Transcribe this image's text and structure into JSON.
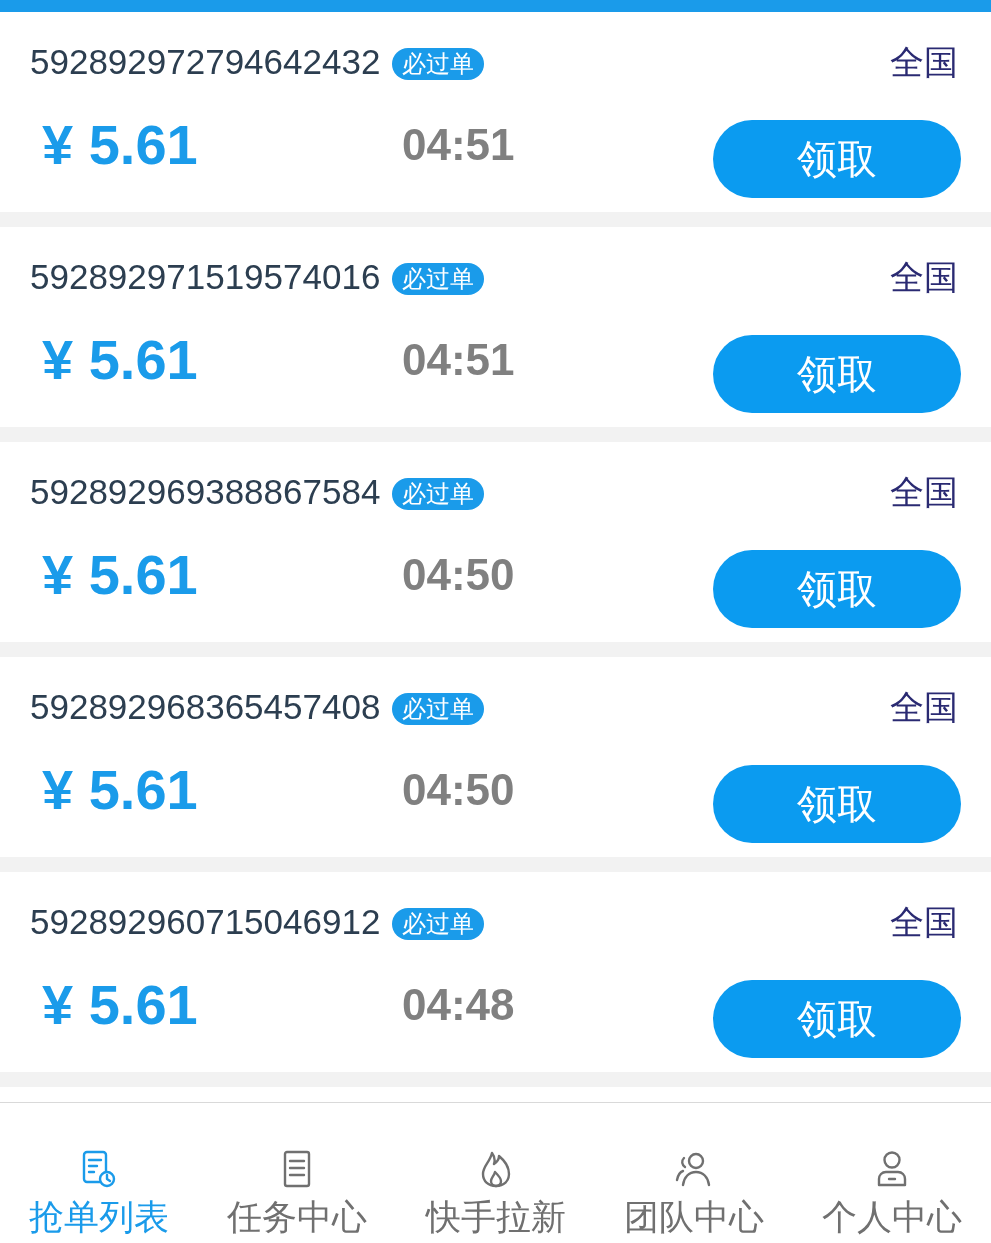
{
  "orders": [
    {
      "order_id": "592892972794642432",
      "badge": "必过单",
      "region": "全国",
      "price": "¥ 5.61",
      "countdown": "04:51",
      "button": "领取"
    },
    {
      "order_id": "592892971519574016",
      "badge": "必过单",
      "region": "全国",
      "price": "¥ 5.61",
      "countdown": "04:51",
      "button": "领取"
    },
    {
      "order_id": "592892969388867584",
      "badge": "必过单",
      "region": "全国",
      "price": "¥ 5.61",
      "countdown": "04:50",
      "button": "领取"
    },
    {
      "order_id": "592892968365457408",
      "badge": "必过单",
      "region": "全国",
      "price": "¥ 5.61",
      "countdown": "04:50",
      "button": "领取"
    },
    {
      "order_id": "592892960715046912",
      "badge": "必过单",
      "region": "全国",
      "price": "¥ 5.61",
      "countdown": "04:48",
      "button": "领取"
    }
  ],
  "bottom_nav": [
    {
      "label": "抢单列表",
      "kind": "orders",
      "selected": true
    },
    {
      "label": "任务中心",
      "kind": "tasks",
      "selected": false
    },
    {
      "label": "快手拉新",
      "kind": "fire",
      "selected": false
    },
    {
      "label": "团队中心",
      "kind": "team",
      "selected": false
    },
    {
      "label": "个人中心",
      "kind": "profile",
      "selected": false
    }
  ]
}
